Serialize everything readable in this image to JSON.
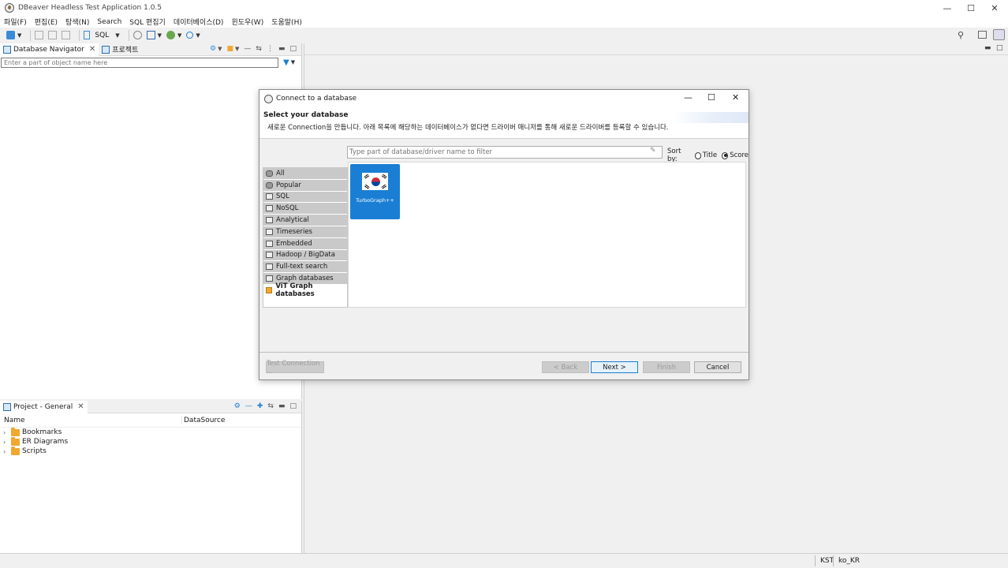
{
  "window": {
    "title": "DBeaver Headless Test Application 1.0.5"
  },
  "menubar": [
    "파일(F)",
    "편집(E)",
    "탐색(N)",
    "Search",
    "SQL 편집기",
    "데이터베이스(D)",
    "윈도우(W)",
    "도움말(H)"
  ],
  "toolbar": {
    "sql_label": "SQL"
  },
  "navigator": {
    "tab_label": "Database Navigator",
    "tab2_label": "프로젝트",
    "filter_placeholder": "Enter a part of object name here"
  },
  "project": {
    "tab_label": "Project - General",
    "col_name": "Name",
    "col_datasource": "DataSource",
    "items": [
      "Bookmarks",
      "ER Diagrams",
      "Scripts"
    ]
  },
  "dialog": {
    "title": "Connect to a database",
    "header_title": "Select your database",
    "header_desc": "새로운 Connection을 만듭니다. 아래 목록에 해당하는 데이터베이스가 없다면 드라이버 매니저를 통해 새로운 드라이버를 등록할 수 있습니다.",
    "search_placeholder": "Type part of database/driver name to filter",
    "sort_label": "Sort by:",
    "sort_title": "Title",
    "sort_score": "Score",
    "categories": [
      "All",
      "Popular",
      "SQL",
      "NoSQL",
      "Analytical",
      "Timeseries",
      "Embedded",
      "Hadoop / BigData",
      "Full-text search",
      "Graph databases",
      "ViT Graph databases"
    ],
    "driver_name": "TurboGraph++",
    "buttons": {
      "test": "Test Connection ...",
      "back": "< Back",
      "next": "Next >",
      "finish": "Finish",
      "cancel": "Cancel"
    }
  },
  "status": {
    "timezone": "KST",
    "locale": "ko_KR"
  },
  "colors": {
    "accent": "#1a7fd4",
    "folder": "#f0a830"
  }
}
